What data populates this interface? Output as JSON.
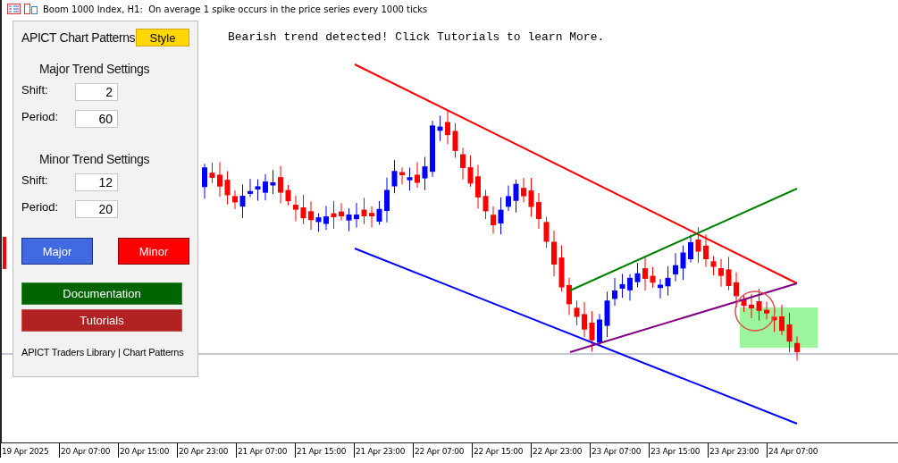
{
  "window": {
    "title": "Boom 1000 Index, H1:  On average 1 spike occurs in the price series every 1000 ticks"
  },
  "panel": {
    "title": "APICT Chart Patterns",
    "style_button": "Style",
    "sections": [
      {
        "heading": "Major Trend Settings",
        "fields": [
          {
            "label": "Shift:",
            "value": "2"
          },
          {
            "label": "Period:",
            "value": "60"
          }
        ]
      },
      {
        "heading": "Minor Trend Settings",
        "fields": [
          {
            "label": "Shift:",
            "value": "12"
          },
          {
            "label": "Period:",
            "value": "20"
          }
        ]
      }
    ],
    "mode_buttons": [
      {
        "label": "Major",
        "kind": "major"
      },
      {
        "label": "Minor",
        "kind": "minor"
      }
    ],
    "link_buttons": [
      {
        "label": "Documentation",
        "kind": "docs"
      },
      {
        "label": "Tutorials",
        "kind": "tutorials"
      }
    ],
    "footer": "APICT Traders Library | Chart Patterns"
  },
  "alert": "Bearish trend detected! Click Tutorials to learn More.",
  "time_axis": [
    "19 Apr 2025",
    "20 Apr 07:00",
    "20 Apr 15:00",
    "20 Apr 23:00",
    "21 Apr 07:00",
    "21 Apr 15:00",
    "21 Apr 23:00",
    "22 Apr 07:00",
    "22 Apr 15:00",
    "22 Apr 23:00",
    "23 Apr 07:00",
    "23 Apr 15:00",
    "23 Apr 23:00",
    "24 Apr 07:00"
  ]
}
